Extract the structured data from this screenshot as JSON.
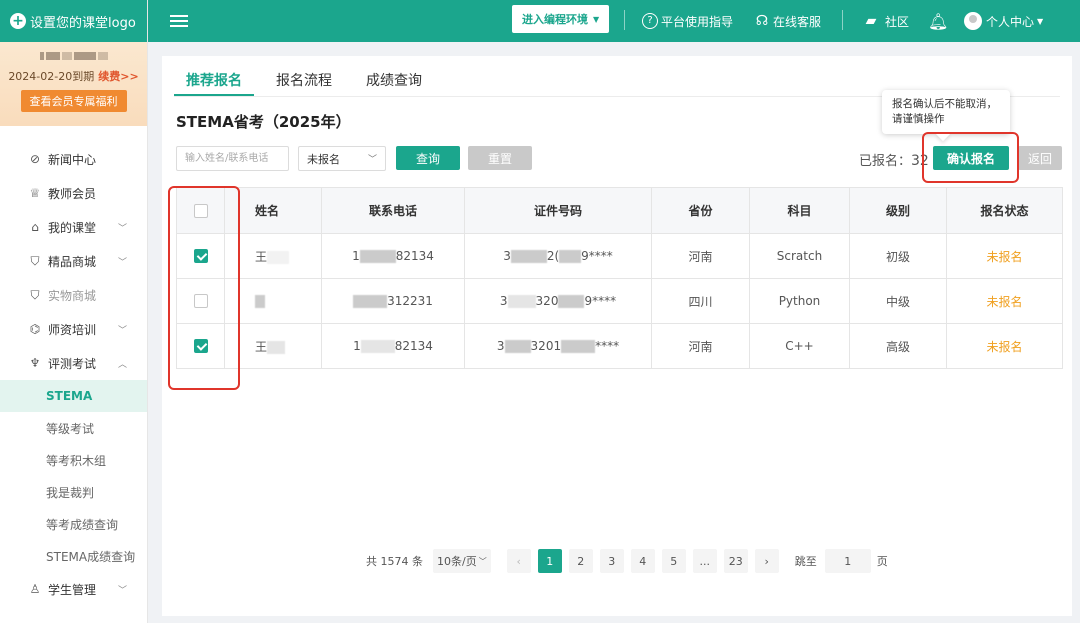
{
  "sidebar": {
    "logo_text": "设置您的课堂logo",
    "member": {
      "period": "2024-02-20到期",
      "renew": "续费>>",
      "benefit_button": "查看会员专属福利"
    },
    "menu": [
      {
        "icon": "news-icon",
        "glyph": "⊘",
        "label": "新闻中心"
      },
      {
        "icon": "teacher-icon",
        "glyph": "♕",
        "label": "教师会员"
      },
      {
        "icon": "class-icon",
        "glyph": "⌂",
        "label": "我的课堂",
        "chevron": "﹀"
      },
      {
        "icon": "shop-icon",
        "glyph": "⛉",
        "label": "精品商城",
        "chevron": "﹀"
      },
      {
        "icon": "physical-shop-icon",
        "glyph": "⛉",
        "label": "实物商城"
      },
      {
        "icon": "training-icon",
        "glyph": "⌬",
        "label": "师资培训",
        "chevron": "﹀"
      },
      {
        "icon": "trophy-icon",
        "glyph": "♆",
        "label": "评测考试",
        "chevron": "︿"
      }
    ],
    "submenu": [
      "STEMA",
      "等级考试",
      "等考积木组",
      "我是裁判",
      "等考成绩查询",
      "STEMA成绩查询"
    ],
    "last_item": {
      "icon": "student-icon",
      "glyph": "♙",
      "label": "学生管理",
      "chevron": "﹀"
    }
  },
  "header": {
    "env_button": "进入编程环境",
    "links": {
      "guide": "平台使用指导",
      "service": "在线客服",
      "community": "社区",
      "user": "个人中心"
    }
  },
  "tabs": [
    "推荐报名",
    "报名流程",
    "成绩查询"
  ],
  "page_title": "STEMA省考（2025年）",
  "filters": {
    "search_placeholder": "输入姓名/联系电话",
    "status_value": "未报名",
    "query_button": "查询",
    "reset_button": "重置"
  },
  "registered": {
    "label": "已报名：",
    "count": "32"
  },
  "confirm_button": "确认报名",
  "back_button": "返回",
  "tooltip": {
    "line1": "报名确认后不能取消，",
    "line2": "请谨慎操作"
  },
  "table": {
    "headers": [
      "姓名",
      "联系电话",
      "证件号码",
      "省份",
      "科目",
      "级别",
      "报名状态"
    ],
    "rows": [
      {
        "checked": true,
        "name": "王",
        "phone_prefix": "1",
        "phone_suffix": "82134",
        "id_prefix": "3",
        "id_mid": "2(",
        "id_suffix": "9****",
        "province": "河南",
        "subject": "Scratch",
        "level": "初级",
        "status": "未报名"
      },
      {
        "checked": false,
        "name": "",
        "phone_prefix": "",
        "phone_suffix": "312231",
        "id_prefix": "3",
        "id_mid": "320",
        "id_suffix": "9****",
        "province": "四川",
        "subject": "Python",
        "level": "中级",
        "status": "未报名"
      },
      {
        "checked": true,
        "name": "王",
        "phone_prefix": "1",
        "phone_suffix": "82134",
        "id_prefix": "3",
        "id_mid": "3201",
        "id_suffix": "****",
        "province": "河南",
        "subject": "C++",
        "level": "高级",
        "status": "未报名"
      }
    ]
  },
  "pagination": {
    "total": "共 1574 条",
    "page_size": "10条/页",
    "pages": [
      "1",
      "2",
      "3",
      "4",
      "5",
      "...",
      "23"
    ],
    "current": "1",
    "jump_label": "跳至",
    "jump_value": "1",
    "page_unit": "页"
  }
}
